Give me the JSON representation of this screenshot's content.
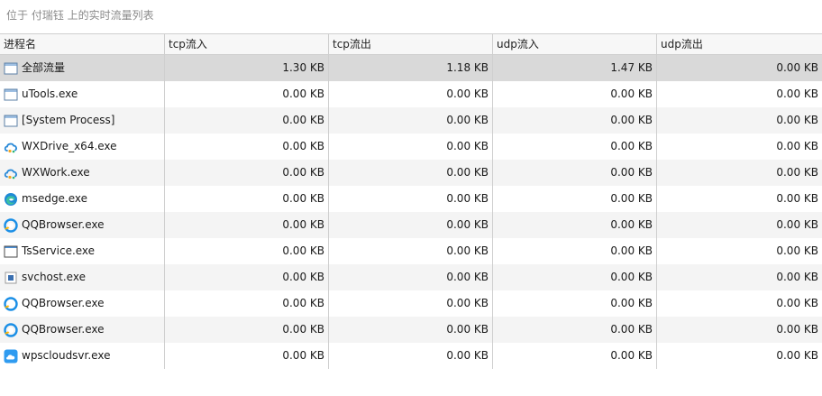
{
  "subtitle": "位于 付瑞钰 上的实时流量列表",
  "columns": [
    "进程名",
    "tcp流入",
    "tcp流出",
    "udp流入",
    "udp流出"
  ],
  "rows": [
    {
      "name": "全部流量",
      "icon": "window-icon",
      "tcp_in": "1.30 KB",
      "tcp_out": "1.18 KB",
      "udp_in": "1.47 KB",
      "udp_out": "0.00 KB"
    },
    {
      "name": "uTools.exe",
      "icon": "window-icon",
      "tcp_in": "0.00 KB",
      "tcp_out": "0.00 KB",
      "udp_in": "0.00 KB",
      "udp_out": "0.00 KB"
    },
    {
      "name": "[System Process]",
      "icon": "window-icon",
      "tcp_in": "0.00 KB",
      "tcp_out": "0.00 KB",
      "udp_in": "0.00 KB",
      "udp_out": "0.00 KB"
    },
    {
      "name": "WXDrive_x64.exe",
      "icon": "wx-cloud-icon",
      "tcp_in": "0.00 KB",
      "tcp_out": "0.00 KB",
      "udp_in": "0.00 KB",
      "udp_out": "0.00 KB"
    },
    {
      "name": "WXWork.exe",
      "icon": "wx-cloud-icon",
      "tcp_in": "0.00 KB",
      "tcp_out": "0.00 KB",
      "udp_in": "0.00 KB",
      "udp_out": "0.00 KB"
    },
    {
      "name": "msedge.exe",
      "icon": "edge-icon",
      "tcp_in": "0.00 KB",
      "tcp_out": "0.00 KB",
      "udp_in": "0.00 KB",
      "udp_out": "0.00 KB"
    },
    {
      "name": "QQBrowser.exe",
      "icon": "qqbrowser-icon",
      "tcp_in": "0.00 KB",
      "tcp_out": "0.00 KB",
      "udp_in": "0.00 KB",
      "udp_out": "0.00 KB"
    },
    {
      "name": "TsService.exe",
      "icon": "blank-window-icon",
      "tcp_in": "0.00 KB",
      "tcp_out": "0.00 KB",
      "udp_in": "0.00 KB",
      "udp_out": "0.00 KB"
    },
    {
      "name": "svchost.exe",
      "icon": "service-icon",
      "tcp_in": "0.00 KB",
      "tcp_out": "0.00 KB",
      "udp_in": "0.00 KB",
      "udp_out": "0.00 KB"
    },
    {
      "name": "QQBrowser.exe",
      "icon": "qqbrowser-icon",
      "tcp_in": "0.00 KB",
      "tcp_out": "0.00 KB",
      "udp_in": "0.00 KB",
      "udp_out": "0.00 KB"
    },
    {
      "name": "QQBrowser.exe",
      "icon": "qqbrowser-icon",
      "tcp_in": "0.00 KB",
      "tcp_out": "0.00 KB",
      "udp_in": "0.00 KB",
      "udp_out": "0.00 KB"
    },
    {
      "name": "wpscloudsvr.exe",
      "icon": "wps-cloud-icon",
      "tcp_in": "0.00 KB",
      "tcp_out": "0.00 KB",
      "udp_in": "0.00 KB",
      "udp_out": "0.00 KB"
    }
  ],
  "colors": {
    "selected_row": "#d9d9d9",
    "alt_row": "#f4f4f4",
    "header_bg": "#f7f7f7",
    "grid_line": "#cfcfcf",
    "subtitle_text": "#8a8a8a"
  }
}
